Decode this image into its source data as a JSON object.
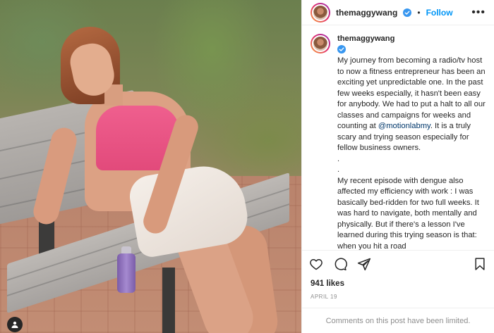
{
  "post": {
    "username": "themaggywang",
    "follow_label": "Follow",
    "separator": "•",
    "more_label": "•••"
  },
  "caption": {
    "username": "themaggywang",
    "text_part1": "My journey from becoming a radio/tv host to now a fitness entrepreneur has been an exciting yet unpredictable one. In the past few weeks especially, it hasn't been easy for anybody. We had to put a halt to all our classes and campaigns for weeks and counting at ",
    "mention": "@motionlabmy",
    "text_part2": ". It is a truly scary and trying season especially for fellow business owners.\n.\n.\nMy recent episode with dengue also affected my efficiency with work : I was basically bed-ridden for two full weeks. It was hard to navigate, both mentally and physically. But if there's a lesson I've learned during this trying season is that: when you hit a road"
  },
  "stats": {
    "likes": "941 likes",
    "date": "APRIL 19"
  },
  "footer": {
    "comments_disabled": "Comments on this post have been limited."
  },
  "icons": {
    "header_more": "more-icon",
    "verified": "verified-badge-icon",
    "like": "heart-icon",
    "comment": "comment-icon",
    "share": "share-icon",
    "save": "bookmark-icon",
    "tag": "user-tag-icon"
  },
  "colors": {
    "accent": "#0095f6",
    "verified": "#3897f0",
    "mention": "#00376b",
    "muted": "#8e8e8e"
  }
}
